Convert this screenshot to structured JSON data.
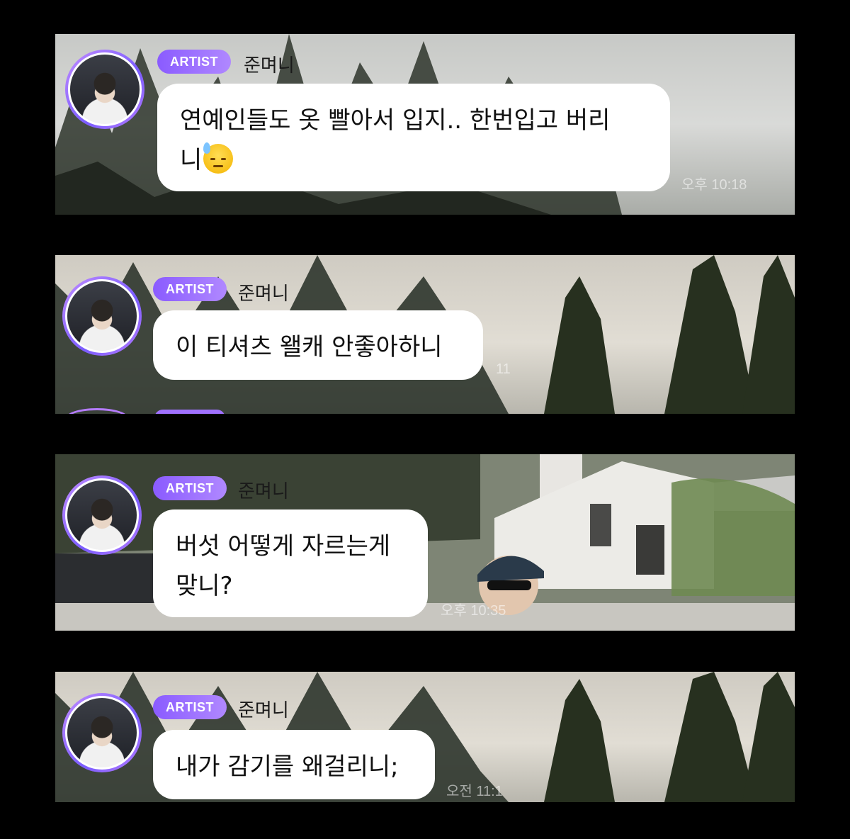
{
  "messages": [
    {
      "badge": "ARTIST",
      "name": "준며니",
      "text_line1": "연예인들도 옷 빨아서 입지.. 한번입고 버리",
      "text_line2": "니",
      "emoji": "sweat-face-emoji",
      "time": "오후 10:18"
    },
    {
      "badge": "ARTIST",
      "name": "준며니",
      "text_line1": "이 티셔츠 왤캐 안좋아하니",
      "time": "11"
    },
    {
      "badge": "ARTIST",
      "name": "준며니",
      "text_line1": "버섯 어떻게 자르는게",
      "text_line2": "맞니?",
      "time": "오후 10:35"
    },
    {
      "badge": "ARTIST",
      "name": "준며니",
      "text_line1": "내가 감기를 왜걸리니;",
      "time": "오전 11:1"
    }
  ],
  "colors": {
    "badge": "#8a5bff",
    "avatar_ring": "#b57cff",
    "bubble": "#ffffff",
    "background": "#000000"
  }
}
